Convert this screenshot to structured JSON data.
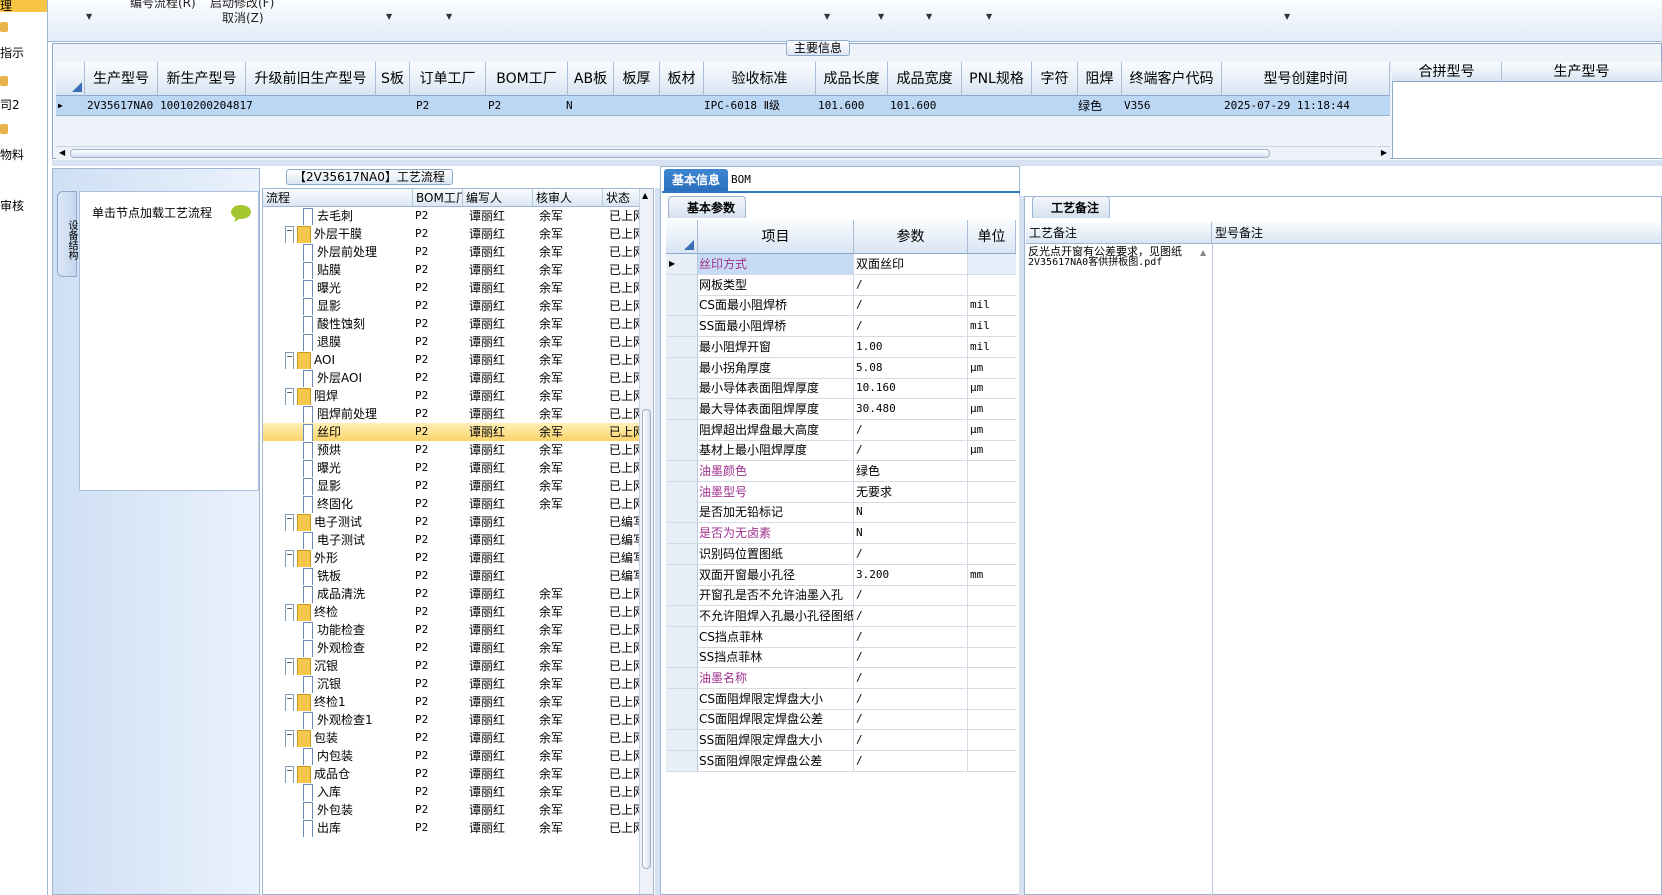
{
  "left_nav": {
    "items": [
      "理",
      "指示",
      "司2",
      "物料",
      "审核"
    ]
  },
  "toolbar": {
    "item1": "编号流程(R)",
    "item2": "启动修改(F)",
    "item3": "取消(Z)"
  },
  "main_info": {
    "title": "主要信息",
    "columns": [
      "生产型号",
      "新生产型号",
      "升级前旧生产型号",
      "S板",
      "订单工厂",
      "BOM工厂",
      "AB板",
      "板厚",
      "板材",
      "验收标准",
      "成品长度",
      "成品宽度",
      "PNL规格",
      "字符",
      "阻焊",
      "终端客户代码",
      "型号创建时间"
    ],
    "row": {
      "prod_model": "2V35617NA0",
      "new_model": "10010200204817",
      "old_model": "",
      "s_board": "",
      "order_factory": "P2",
      "bom_factory": "P2",
      "ab_board": "N",
      "thickness": "",
      "material": "",
      "standard": "IPC-6018 Ⅱ级",
      "length": "101.600",
      "width": "101.600",
      "pnl": "",
      "char": "",
      "solder": "绿色",
      "customer_code": "V356",
      "created": "2025-07-29 11:18:44"
    },
    "side_columns": [
      "合拼型号",
      "生产型号"
    ]
  },
  "left_panel": {
    "vtab_label": "设备结构",
    "node_hint": "单击节点加载工艺流程"
  },
  "process": {
    "title": "【2V35617NA0】工艺流程",
    "columns": [
      "流程",
      "BOM工厂",
      "编写人",
      "核审人",
      "状态"
    ],
    "rows": [
      {
        "level": 2,
        "type": "doc",
        "name": "去毛刺",
        "factory": "P2",
        "writer": "谭丽红",
        "reviewer": "余军",
        "status": "已上网"
      },
      {
        "level": 1,
        "type": "folder",
        "name": "外层干膜",
        "factory": "P2",
        "writer": "谭丽红",
        "reviewer": "余军",
        "status": "已上网"
      },
      {
        "level": 2,
        "type": "doc",
        "name": "外层前处理",
        "factory": "P2",
        "writer": "谭丽红",
        "reviewer": "余军",
        "status": "已上网"
      },
      {
        "level": 2,
        "type": "doc",
        "name": "贴膜",
        "factory": "P2",
        "writer": "谭丽红",
        "reviewer": "余军",
        "status": "已上网"
      },
      {
        "level": 2,
        "type": "doc",
        "name": "曝光",
        "factory": "P2",
        "writer": "谭丽红",
        "reviewer": "余军",
        "status": "已上网"
      },
      {
        "level": 2,
        "type": "doc",
        "name": "显影",
        "factory": "P2",
        "writer": "谭丽红",
        "reviewer": "余军",
        "status": "已上网"
      },
      {
        "level": 2,
        "type": "doc",
        "name": "酸性蚀刻",
        "factory": "P2",
        "writer": "谭丽红",
        "reviewer": "余军",
        "status": "已上网"
      },
      {
        "level": 2,
        "type": "doc",
        "name": "退膜",
        "factory": "P2",
        "writer": "谭丽红",
        "reviewer": "余军",
        "status": "已上网"
      },
      {
        "level": 1,
        "type": "folder",
        "name": "AOI",
        "factory": "P2",
        "writer": "谭丽红",
        "reviewer": "余军",
        "status": "已上网"
      },
      {
        "level": 2,
        "type": "doc",
        "name": "外层AOI",
        "factory": "P2",
        "writer": "谭丽红",
        "reviewer": "余军",
        "status": "已上网"
      },
      {
        "level": 1,
        "type": "folder",
        "name": "阻焊",
        "factory": "P2",
        "writer": "谭丽红",
        "reviewer": "余军",
        "status": "已上网"
      },
      {
        "level": 2,
        "type": "doc",
        "name": "阻焊前处理",
        "factory": "P2",
        "writer": "谭丽红",
        "reviewer": "余军",
        "status": "已上网"
      },
      {
        "level": 2,
        "type": "doc",
        "name": "丝印",
        "factory": "P2",
        "writer": "谭丽红",
        "reviewer": "余军",
        "status": "已上网",
        "selected": true
      },
      {
        "level": 2,
        "type": "doc",
        "name": "预烘",
        "factory": "P2",
        "writer": "谭丽红",
        "reviewer": "余军",
        "status": "已上网"
      },
      {
        "level": 2,
        "type": "doc",
        "name": "曝光",
        "factory": "P2",
        "writer": "谭丽红",
        "reviewer": "余军",
        "status": "已上网"
      },
      {
        "level": 2,
        "type": "doc",
        "name": "显影",
        "factory": "P2",
        "writer": "谭丽红",
        "reviewer": "余军",
        "status": "已上网"
      },
      {
        "level": 2,
        "type": "doc",
        "name": "终固化",
        "factory": "P2",
        "writer": "谭丽红",
        "reviewer": "余军",
        "status": "已上网"
      },
      {
        "level": 1,
        "type": "folder",
        "name": "电子测试",
        "factory": "P2",
        "writer": "谭丽红",
        "reviewer": "",
        "status": "已编写"
      },
      {
        "level": 2,
        "type": "doc",
        "name": "电子测试",
        "factory": "P2",
        "writer": "谭丽红",
        "reviewer": "",
        "status": "已编写"
      },
      {
        "level": 1,
        "type": "folder",
        "name": "外形",
        "factory": "P2",
        "writer": "谭丽红",
        "reviewer": "",
        "status": "已编写"
      },
      {
        "level": 2,
        "type": "doc",
        "name": "铣板",
        "factory": "P2",
        "writer": "谭丽红",
        "reviewer": "",
        "status": "已编写"
      },
      {
        "level": 2,
        "type": "doc",
        "name": "成品清洗",
        "factory": "P2",
        "writer": "谭丽红",
        "reviewer": "余军",
        "status": "已上网"
      },
      {
        "level": 1,
        "type": "folder",
        "name": "终检",
        "factory": "P2",
        "writer": "谭丽红",
        "reviewer": "余军",
        "status": "已上网"
      },
      {
        "level": 2,
        "type": "doc",
        "name": "功能检查",
        "factory": "P2",
        "writer": "谭丽红",
        "reviewer": "余军",
        "status": "已上网"
      },
      {
        "level": 2,
        "type": "doc",
        "name": "外观检查",
        "factory": "P2",
        "writer": "谭丽红",
        "reviewer": "余军",
        "status": "已上网"
      },
      {
        "level": 1,
        "type": "folder",
        "name": "沉银",
        "factory": "P2",
        "writer": "谭丽红",
        "reviewer": "余军",
        "status": "已上网"
      },
      {
        "level": 2,
        "type": "doc",
        "name": "沉银",
        "factory": "P2",
        "writer": "谭丽红",
        "reviewer": "余军",
        "status": "已上网"
      },
      {
        "level": 1,
        "type": "folder",
        "name": "终检1",
        "factory": "P2",
        "writer": "谭丽红",
        "reviewer": "余军",
        "status": "已上网"
      },
      {
        "level": 2,
        "type": "doc",
        "name": "外观检查1",
        "factory": "P2",
        "writer": "谭丽红",
        "reviewer": "余军",
        "status": "已上网"
      },
      {
        "level": 1,
        "type": "folder",
        "name": "包装",
        "factory": "P2",
        "writer": "谭丽红",
        "reviewer": "余军",
        "status": "已上网"
      },
      {
        "level": 2,
        "type": "doc",
        "name": "内包装",
        "factory": "P2",
        "writer": "谭丽红",
        "reviewer": "余军",
        "status": "已上网"
      },
      {
        "level": 1,
        "type": "folder",
        "name": "成品仓",
        "factory": "P2",
        "writer": "谭丽红",
        "reviewer": "余军",
        "status": "已上网"
      },
      {
        "level": 2,
        "type": "doc",
        "name": "入库",
        "factory": "P2",
        "writer": "谭丽红",
        "reviewer": "余军",
        "status": "已上网"
      },
      {
        "level": 2,
        "type": "doc",
        "name": "外包装",
        "factory": "P2",
        "writer": "谭丽红",
        "reviewer": "余军",
        "status": "已上网"
      },
      {
        "level": 2,
        "type": "doc",
        "name": "出库",
        "factory": "P2",
        "writer": "谭丽红",
        "reviewer": "余军",
        "status": "已上网"
      }
    ]
  },
  "tabs": {
    "basic_info": "基本信息",
    "bom": "BOM",
    "basic_params": "基本参数",
    "process_notes": "工艺备注"
  },
  "params": {
    "columns": [
      "项目",
      "参数",
      "单位"
    ],
    "rows": [
      {
        "item": "丝印方式",
        "value": "双面丝印",
        "unit": "",
        "highlight": true
      },
      {
        "item": "网板类型",
        "value": "/",
        "unit": ""
      },
      {
        "item": "CS面最小阻焊桥",
        "value": "/",
        "unit": "mil"
      },
      {
        "item": "SS面最小阻焊桥",
        "value": "/",
        "unit": "mil"
      },
      {
        "item": "最小阻焊开窗",
        "value": "1.00",
        "unit": "mil"
      },
      {
        "item": "最小拐角厚度",
        "value": "5.08",
        "unit": "μm"
      },
      {
        "item": "最小导体表面阻焊厚度",
        "value": "10.160",
        "unit": "μm"
      },
      {
        "item": "最大导体表面阻焊厚度",
        "value": "30.480",
        "unit": "μm"
      },
      {
        "item": "阻焊超出焊盘最大高度",
        "value": "/",
        "unit": "μm"
      },
      {
        "item": "基材上最小阻焊厚度",
        "value": "/",
        "unit": "μm"
      },
      {
        "item": "油墨颜色",
        "value": "绿色",
        "unit": "",
        "highlight": true
      },
      {
        "item": "油墨型号",
        "value": "无要求",
        "unit": "",
        "highlight": true
      },
      {
        "item": "是否加无铅标记",
        "value": "N",
        "unit": ""
      },
      {
        "item": "是否为无卤素",
        "value": "N",
        "unit": "",
        "highlight": true
      },
      {
        "item": "识别码位置图纸",
        "value": "/",
        "unit": ""
      },
      {
        "item": "双面开窗最小孔径",
        "value": "3.200",
        "unit": "mm"
      },
      {
        "item": "开窗孔是否不允许油墨入孔",
        "value": "/",
        "unit": ""
      },
      {
        "item": "不允许阻焊入孔最小孔径图纸",
        "value": "/",
        "unit": ""
      },
      {
        "item": "CS挡点菲林",
        "value": "/",
        "unit": ""
      },
      {
        "item": "SS挡点菲林",
        "value": "/",
        "unit": ""
      },
      {
        "item": "油墨名称",
        "value": "/",
        "unit": "",
        "highlight": true
      },
      {
        "item": "CS面阻焊限定焊盘大小",
        "value": "/",
        "unit": ""
      },
      {
        "item": "CS面阻焊限定焊盘公差",
        "value": "/",
        "unit": ""
      },
      {
        "item": "SS面阻焊限定焊盘大小",
        "value": "/",
        "unit": ""
      },
      {
        "item": "SS面阻焊限定焊盘公差",
        "value": "/",
        "unit": ""
      }
    ]
  },
  "notes": {
    "col_process_note": "工艺备注",
    "col_model_note": "型号备注",
    "process_note_line1": "反光点开窗有公差要求，见图纸",
    "process_note_line2": "2V35617NA0客供拼板图.pdf"
  },
  "colors": {
    "highlight_text": "#a0308f",
    "selected_row": "#bcd7f4",
    "tab_blue": "#2f78c6",
    "tree_selected": "#fbd36a"
  }
}
